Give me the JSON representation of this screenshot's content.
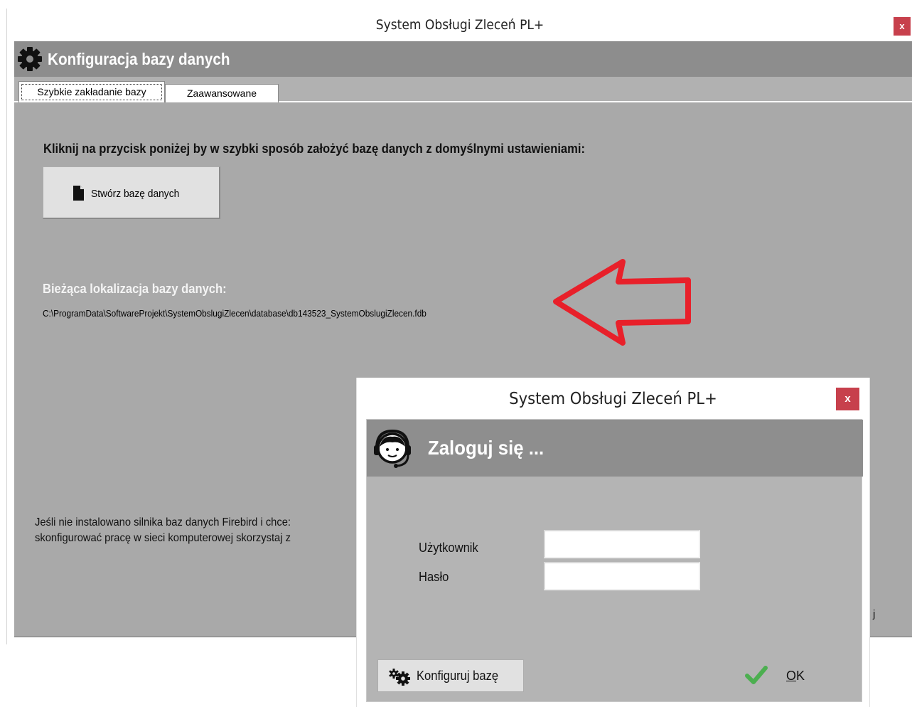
{
  "main_window": {
    "title": "System Obsługi Zleceń PL+",
    "close_label": "x",
    "heading": "Konfiguracja bazy danych",
    "tabs": [
      {
        "label": "Szybkie zakładanie bazy",
        "active": true
      },
      {
        "label": "Zaawansowane",
        "active": false
      }
    ],
    "quick_setup": {
      "instruction": "Kliknij na przycisk poniżej by w szybki sposób założyć bazę danych z domyślnymi ustawieniami:",
      "create_button_label": "Stwórz bazę danych",
      "location_label": "Bieżąca lokalizacja bazy danych:",
      "location_path": "C:\\ProgramData\\SoftwareProjekt\\SystemObslugiZlecen\\database\\db143523_SystemObslugiZlecen.fdb",
      "firebird_note_line1": "Jeśli nie instalowano silnika baz danych Firebird i chce:",
      "firebird_note_line2": "skonfigurować pracę w sieci komputerowej skorzystaj z",
      "trailing_fragment": "j"
    }
  },
  "login_dialog": {
    "title": "System Obsługi Zleceń PL+",
    "close_label": "x",
    "heading": "Zaloguj się ...",
    "user_label": "Użytkownik",
    "user_value": "",
    "password_label": "Hasło",
    "password_value": "",
    "configure_button_label": "Konfiguruj bazę",
    "ok_mnemonic": "O",
    "ok_rest": "K"
  },
  "annotation": {
    "arrow_color": "#e8202a"
  },
  "colors": {
    "panel_grey": "#a9a9a9",
    "header_grey": "#8d8d8d",
    "close_red": "#c7404c",
    "check_green": "#4caf50"
  }
}
